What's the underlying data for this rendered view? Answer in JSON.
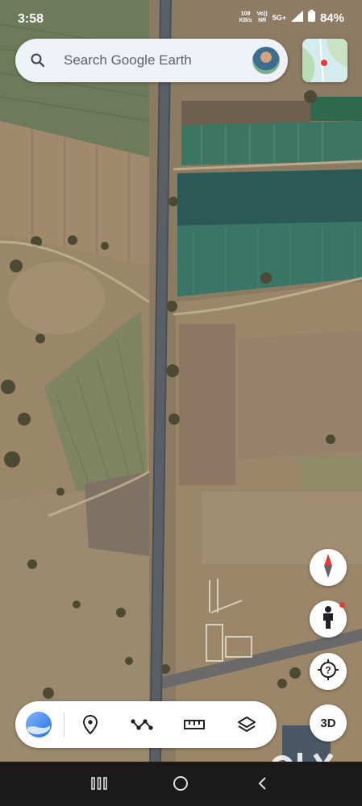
{
  "status_bar": {
    "time": "3:58",
    "speed_value": "108",
    "speed_unit": "KB/s",
    "volte_top": "Vo))",
    "volte_bottom": "NR",
    "network": "5G+",
    "battery": "84%"
  },
  "search": {
    "placeholder": "Search Google Earth"
  },
  "buttons": {
    "three_d_label": "3D"
  },
  "toolbar": {
    "items": [
      "earth-logo",
      "place-icon",
      "path-icon",
      "ruler-icon",
      "layers-icon"
    ]
  },
  "watermark": {
    "text": "OLX"
  },
  "colors": {
    "compass_red": "#e53935",
    "watermark": "#ffffff"
  }
}
